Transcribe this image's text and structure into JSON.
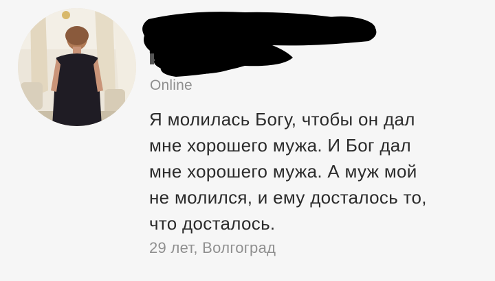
{
  "profile": {
    "status": "Online",
    "bio_lines": [
      "Я молилась Богу, чтобы он дал",
      "мне хорошего мужа. И Бог дал",
      "мне хорошего мужа. А муж мой",
      "не молился, и ему досталось то,",
      "что досталось."
    ],
    "meta": "29 лет, Волгоград"
  }
}
